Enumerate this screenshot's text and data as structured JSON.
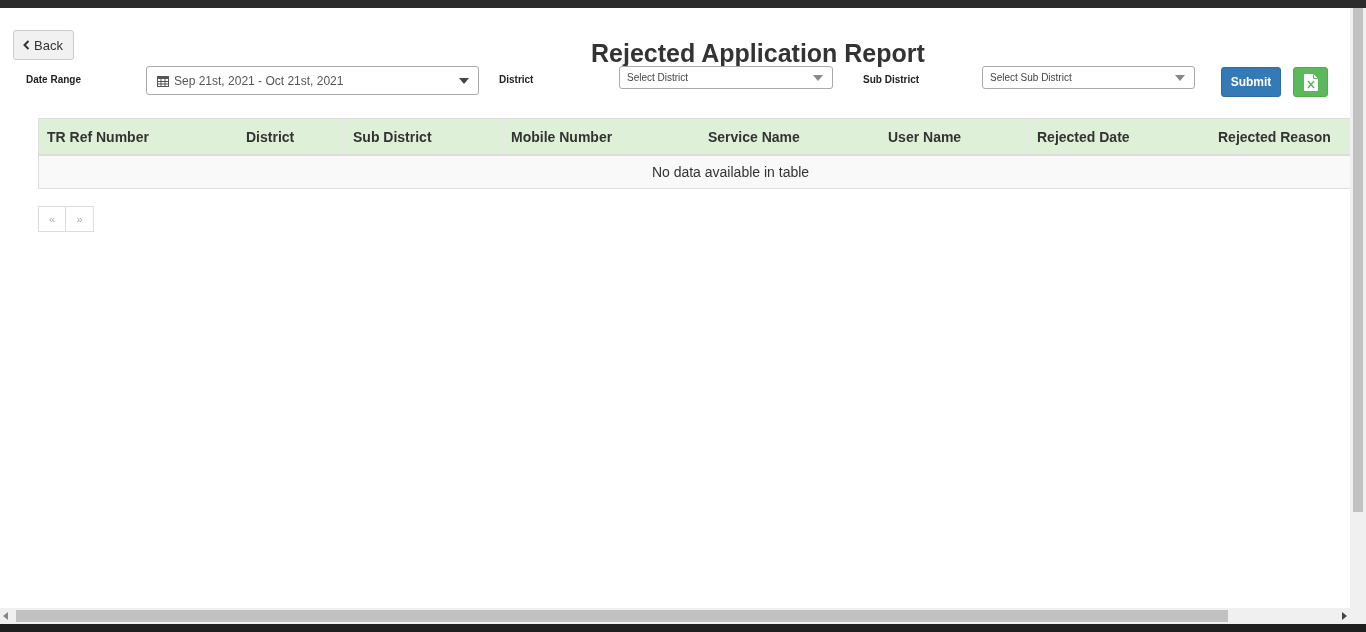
{
  "back_button": {
    "label": "Back"
  },
  "title": "Rejected Application Report",
  "filters": [
    {
      "kind": "daterange",
      "label": "Date Range",
      "value": "Sep 21st, 2021 - Oct 21st, 2021"
    },
    {
      "kind": "select",
      "label": "District",
      "placeholder": "Select District"
    },
    {
      "kind": "select",
      "label": "Sub District",
      "placeholder": "Select Sub District"
    }
  ],
  "submit_button": {
    "label": "Submit"
  },
  "table": {
    "columns": [
      "TR Ref Number",
      "District",
      "Sub District",
      "Mobile Number",
      "Service Name",
      "User Name",
      "Rejected Date",
      "Rejected Reason"
    ],
    "empty_message": "No data available in table"
  },
  "pagination": {
    "previous": "«",
    "next": "»"
  }
}
